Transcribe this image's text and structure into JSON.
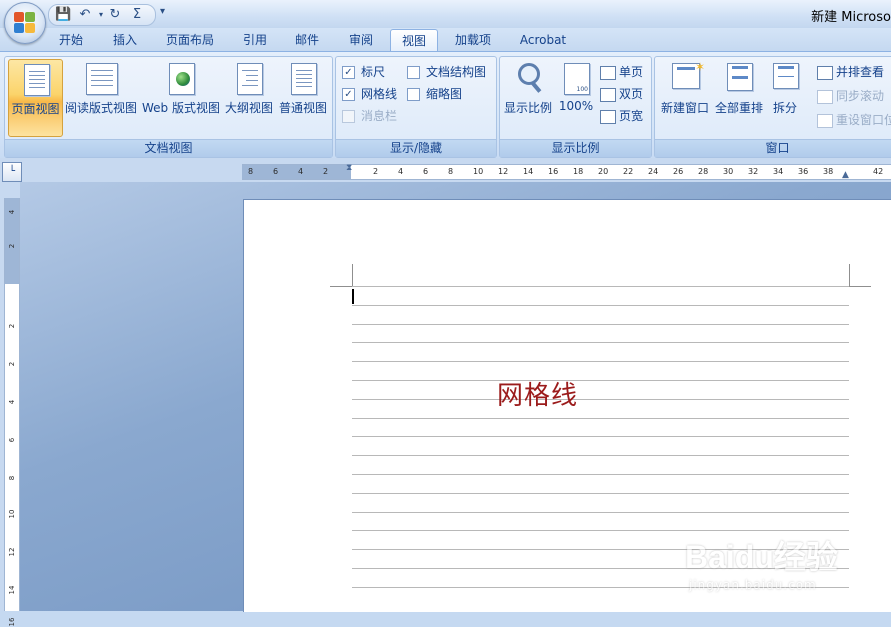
{
  "window": {
    "title": "新建 Microso"
  },
  "quick_access": {
    "icons": [
      "save-icon",
      "undo-icon",
      "undo-dropdown",
      "redo-icon",
      "sigma-icon"
    ]
  },
  "tabs": [
    {
      "label": "开始",
      "active": false
    },
    {
      "label": "插入",
      "active": false
    },
    {
      "label": "页面布局",
      "active": false
    },
    {
      "label": "引用",
      "active": false
    },
    {
      "label": "邮件",
      "active": false
    },
    {
      "label": "审阅",
      "active": false
    },
    {
      "label": "视图",
      "active": true
    },
    {
      "label": "加载项",
      "active": false
    },
    {
      "label": "Acrobat",
      "active": false
    }
  ],
  "ribbon": {
    "doc_views": {
      "label": "文档视图",
      "buttons": [
        "页面视图",
        "阅读版式视图",
        "Web 版式视图",
        "大纲视图",
        "普通视图"
      ]
    },
    "show_hide": {
      "label": "显示/隐藏",
      "ruler": "标尺",
      "gridlines": "网格线",
      "message_bar": "消息栏",
      "doc_map": "文档结构图",
      "thumbnails": "缩略图"
    },
    "zoom": {
      "label": "显示比例",
      "zoom_btn": "显示比例",
      "hundred": "100%",
      "one_page": "单页",
      "two_pages": "双页",
      "page_width": "页宽"
    },
    "window": {
      "label": "窗口",
      "new_window": "新建窗口",
      "arrange_all": "全部重排",
      "split": "拆分",
      "side_by_side": "并排查看",
      "sync_scroll": "同步滚动",
      "reset_pos": "重设窗口位"
    }
  },
  "ruler": {
    "h_ticks": [
      "8",
      "6",
      "4",
      "2",
      "2",
      "4",
      "6",
      "8",
      "10",
      "12",
      "14",
      "16",
      "18",
      "20",
      "22",
      "24",
      "26",
      "28",
      "30",
      "32",
      "34",
      "36",
      "38",
      "42"
    ],
    "v_ticks": [
      "4",
      "2",
      "2",
      "2",
      "4",
      "6",
      "8",
      "10",
      "12",
      "14",
      "16"
    ]
  },
  "document": {
    "text": "网格线"
  },
  "watermark": {
    "brand": "Baidu经验",
    "url": "jingyan.baidu.com"
  },
  "colors": {
    "accent": "#15428b",
    "doc_text": "#9b1b1b",
    "active_button": "#fbd46b"
  }
}
